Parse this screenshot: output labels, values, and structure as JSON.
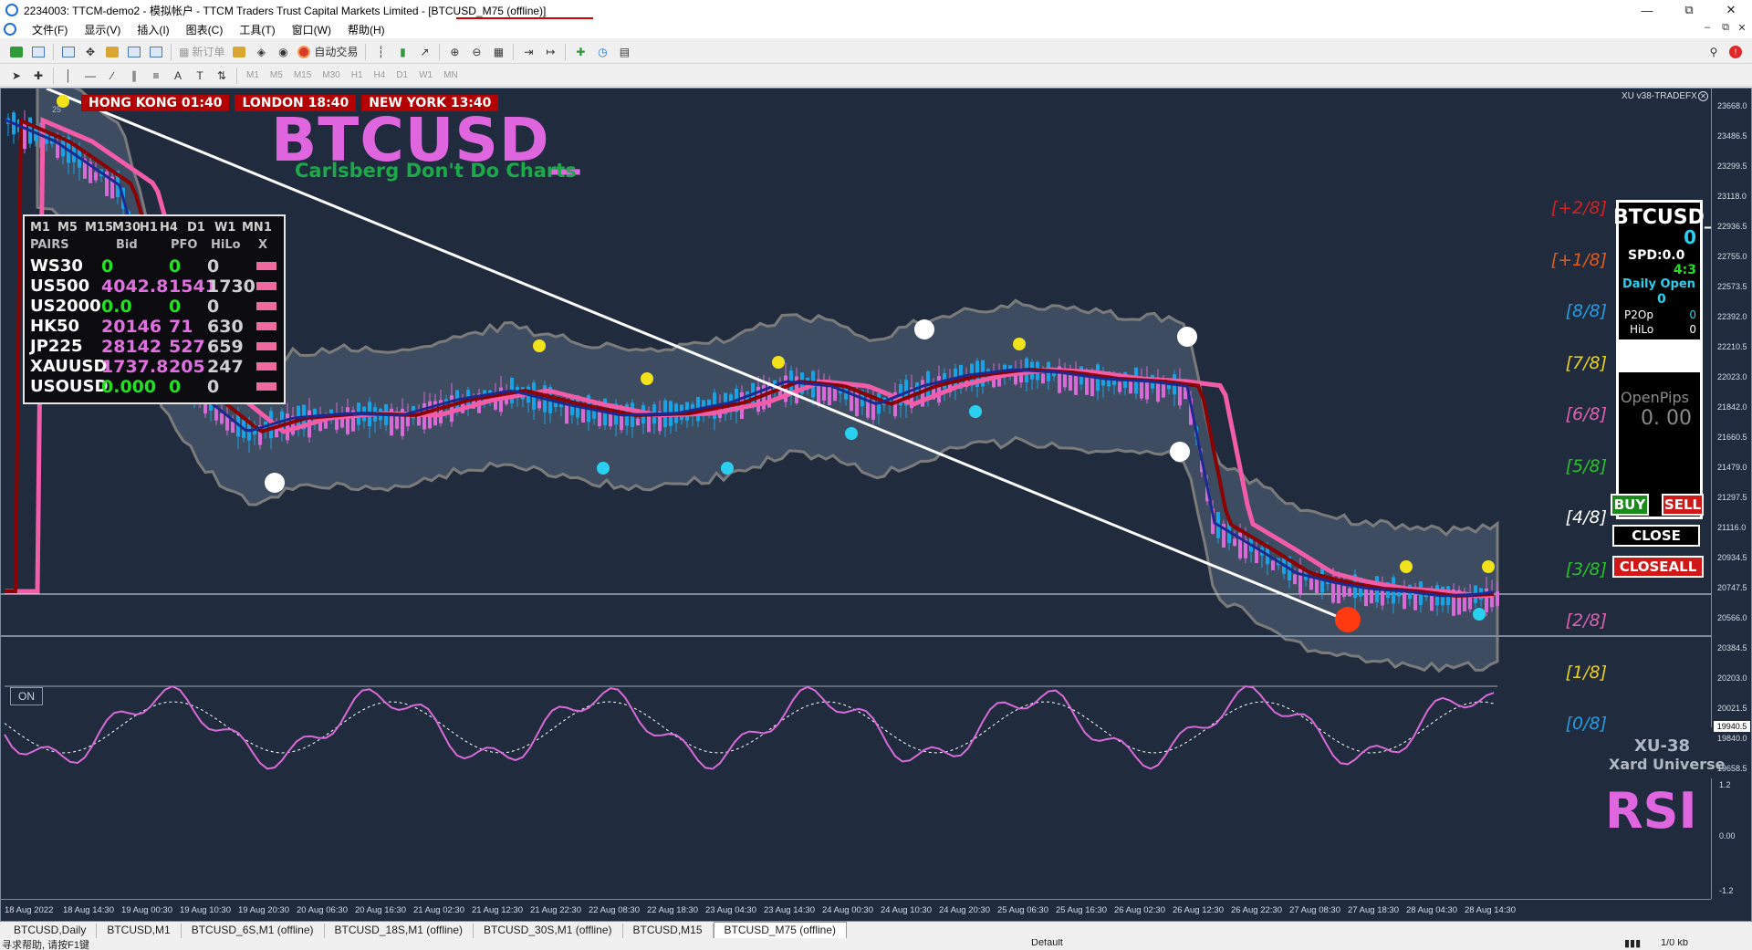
{
  "window": {
    "title": "2234003: TTCM-demo2 - 模拟帐户 - TTCM Traders Trust Capital Markets Limited - [BTCUSD_M75 (offline)]",
    "min_icon": "minimize-icon",
    "max_icon": "restore-icon",
    "close_icon": "close-icon"
  },
  "menu": [
    "文件(F)",
    "显示(V)",
    "插入(I)",
    "图表(C)",
    "工具(T)",
    "窗口(W)",
    "帮助(H)"
  ],
  "toolbar": {
    "new_order": "新订单",
    "auto_trade": "自动交易",
    "timeframes": [
      "M1",
      "M5",
      "M15",
      "M30",
      "H1",
      "H4",
      "D1",
      "W1",
      "MN"
    ]
  },
  "chart": {
    "symbol": "BTCUSD_",
    "subtitle": "Carlsberg Don't Do Charts",
    "sessions": [
      "HONG KONG 01:40",
      "LONDON  18:40",
      "NEW YORK  13:40"
    ],
    "corner_label": "25",
    "on_button": "ON",
    "xu_label": "XU v38-TRADEFX",
    "xu38": "XU-38",
    "xard": "Xard Universe",
    "rsi_title": "RSI",
    "current_price": "19940.5",
    "colors": {
      "bg": "#202c3e",
      "cloud": "#3f4e63",
      "band": "#808080",
      "pink_ma": "#f25ca8",
      "red_ma": "#8b0000",
      "blue_ma": "#1a2a90",
      "up_candle": "#1aa2e6",
      "down_candle": "#d86ad8"
    }
  },
  "pairs_panel": {
    "timeframes": [
      "M1",
      "M5",
      "M15",
      "M30",
      "H1",
      "H4",
      "D1",
      "W1",
      "MN1"
    ],
    "headers": [
      "PAIRS",
      "Bid",
      "PFO",
      "HiLo",
      "X"
    ],
    "rows": [
      {
        "pair": "WS30",
        "bid": "0",
        "pfo": "0",
        "hilo": "0",
        "bid_color": "#22e022",
        "pfo_color": "#22e022"
      },
      {
        "pair": "US500",
        "bid": "4042.8",
        "pfo": "1541",
        "hilo": "1730",
        "bid_color": "#e070e0",
        "pfo_color": "#e070e0"
      },
      {
        "pair": "US2000",
        "bid": "0.0",
        "pfo": "0",
        "hilo": "0",
        "bid_color": "#22e022",
        "pfo_color": "#22e022"
      },
      {
        "pair": "HK50",
        "bid": "20146",
        "pfo": "71",
        "hilo": "630",
        "bid_color": "#e070e0",
        "pfo_color": "#e070e0"
      },
      {
        "pair": "JP225",
        "bid": "28142",
        "pfo": "527",
        "hilo": "659",
        "bid_color": "#e070e0",
        "pfo_color": "#e070e0"
      },
      {
        "pair": "XAUUSD",
        "bid": "1737.8",
        "pfo": "205",
        "hilo": "247",
        "bid_color": "#e070e0",
        "pfo_color": "#e070e0"
      },
      {
        "pair": "USOUSD",
        "bid": "0.000",
        "pfo": "0",
        "hilo": "0",
        "bid_color": "#22e022",
        "pfo_color": "#22e022"
      }
    ]
  },
  "murrey_levels": [
    {
      "label": "[+2/8]",
      "color": "#d42020"
    },
    {
      "label": "[+1/8]",
      "color": "#e05a1a"
    },
    {
      "label": "[8/8]",
      "color": "#2a9ae0"
    },
    {
      "label": "[7/8]",
      "color": "#e8d020"
    },
    {
      "label": "[6/8]",
      "color": "#e060b0"
    },
    {
      "label": "[5/8]",
      "color": "#2ac02a"
    },
    {
      "label": "[4/8]",
      "color": "#ffffff"
    },
    {
      "label": "[3/8]",
      "color": "#2ac02a"
    },
    {
      "label": "[2/8]",
      "color": "#e060b0"
    },
    {
      "label": "[1/8]",
      "color": "#e8d020"
    },
    {
      "label": "[0/8]",
      "color": "#2a9ae0"
    }
  ],
  "info_panel": {
    "symbol": "BTCUSD_",
    "value": "0",
    "spd": "SPD:0.0",
    "ratio": "4:3",
    "daily_open_label": "Daily Open",
    "daily_open_value": "0",
    "p2op_label": "P2Op",
    "p2op_value": "0",
    "hilo_label": "HiLo",
    "hilo_value": "0",
    "openpips_label": "OpenPips",
    "openpips_value": "0. 00"
  },
  "trade_buttons": {
    "buy": "BUY",
    "sell": "SELL",
    "close": "CLOSE",
    "closeall": "CLOSEALL"
  },
  "price_axis": [
    "23668.0",
    "23486.5",
    "23299.5",
    "23118.0",
    "22936.5",
    "22755.0",
    "22573.5",
    "22392.0",
    "22210.5",
    "22023.0",
    "21842.0",
    "21660.5",
    "21479.0",
    "21297.5",
    "21116.0",
    "20934.5",
    "20747.5",
    "20566.0",
    "20384.5",
    "20203.0",
    "20021.5",
    "19840.0",
    "19658.5"
  ],
  "rsi_axis": [
    "1.2",
    "0.00",
    "-1.2"
  ],
  "time_axis": [
    "18 Aug 2022",
    "18 Aug 14:30",
    "19 Aug 00:30",
    "19 Aug 10:30",
    "19 Aug 20:30",
    "20 Aug 06:30",
    "20 Aug 16:30",
    "21 Aug 02:30",
    "21 Aug 12:30",
    "21 Aug 22:30",
    "22 Aug 08:30",
    "22 Aug 18:30",
    "23 Aug 04:30",
    "23 Aug 14:30",
    "24 Aug 00:30",
    "24 Aug 10:30",
    "24 Aug 20:30",
    "25 Aug 06:30",
    "25 Aug 16:30",
    "26 Aug 02:30",
    "26 Aug 12:30",
    "26 Aug 22:30",
    "27 Aug 08:30",
    "27 Aug 18:30",
    "28 Aug 04:30",
    "28 Aug 14:30"
  ],
  "tabs": [
    "BTCUSD,Daily",
    "BTCUSD,M1",
    "BTCUSD_6S,M1 (offline)",
    "BTCUSD_18S,M1 (offline)",
    "BTCUSD_30S,M1 (offline)",
    "BTCUSD,M15",
    "BTCUSD_M75 (offline)"
  ],
  "active_tab": 6,
  "status": {
    "help": "寻求帮助, 请按F1键",
    "profile": "Default",
    "traffic": "1/0 kb"
  }
}
